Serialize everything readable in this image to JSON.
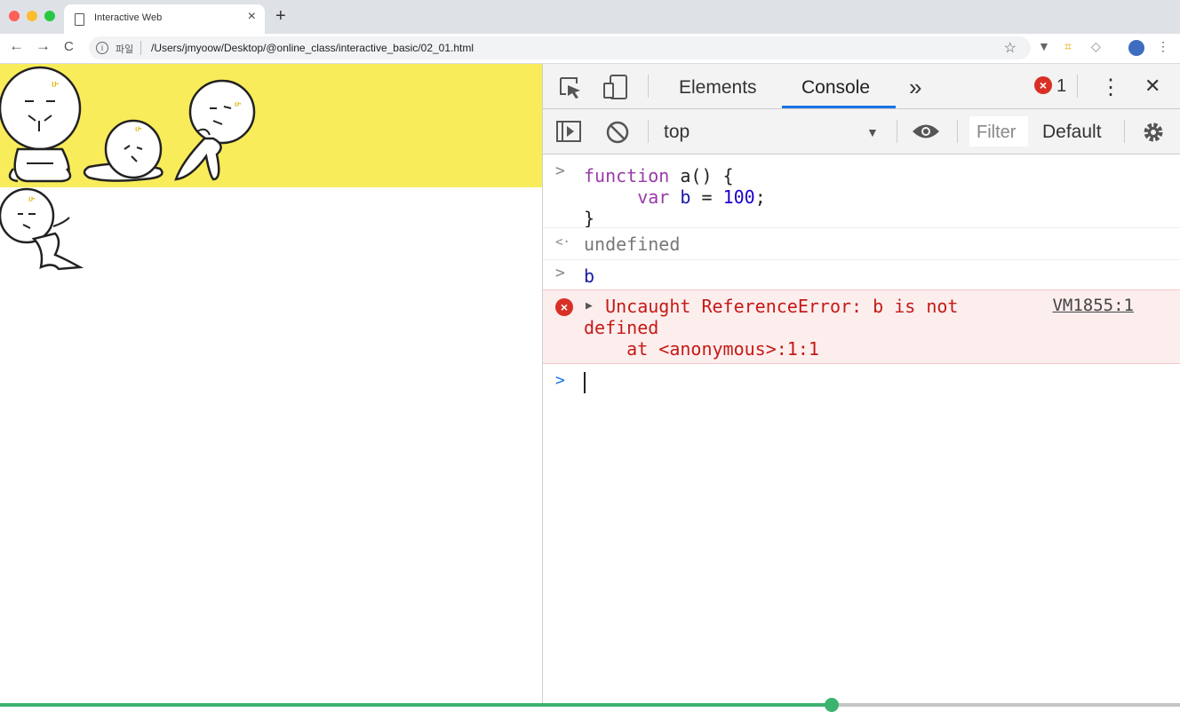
{
  "browser": {
    "tab_title": "Interactive Web",
    "tab_close": "×",
    "new_tab": "+",
    "back": "←",
    "forward": "→",
    "reload": "C",
    "info": "i",
    "scheme_label": "파일",
    "url": "/Users/jmyoow/Desktop/@online_class/interactive_basic/02_01.html",
    "bookmark_star": "☆"
  },
  "devtools": {
    "tabs": [
      {
        "label": "Elements"
      },
      {
        "label": "Console"
      }
    ],
    "more_tabs": "»",
    "error_badge": "×",
    "error_count": "1",
    "menu": "⋮",
    "close": "✕",
    "context": "top",
    "context_arrow": "▼",
    "filter_placeholder": "Filter",
    "level": "Default"
  },
  "console": {
    "input_prompt": ">",
    "output_prompt": "<·",
    "line1_kw": "function",
    "line1_rest": " a() {",
    "line2_indent": "     ",
    "line2_kw": "var",
    "line2_var": " b",
    "line2_op": " = ",
    "line2_num": "100",
    "line2_end": ";",
    "line3": "}",
    "result1": "undefined",
    "input2": "b",
    "error_icon": "×",
    "error_triangle": "▶",
    "error_line1": "Uncaught ReferenceError: b is not",
    "error_line2": "defined",
    "error_line3": "    at <anonymous>:1:1",
    "error_source": "VM1855:1",
    "new_prompt": ">"
  },
  "video_progress": {
    "fraction": 0.705
  },
  "colors": {
    "banner": "#f8ec5a",
    "progress": "#3cb371",
    "error": "#d93025",
    "accent": "#1a73e8"
  }
}
